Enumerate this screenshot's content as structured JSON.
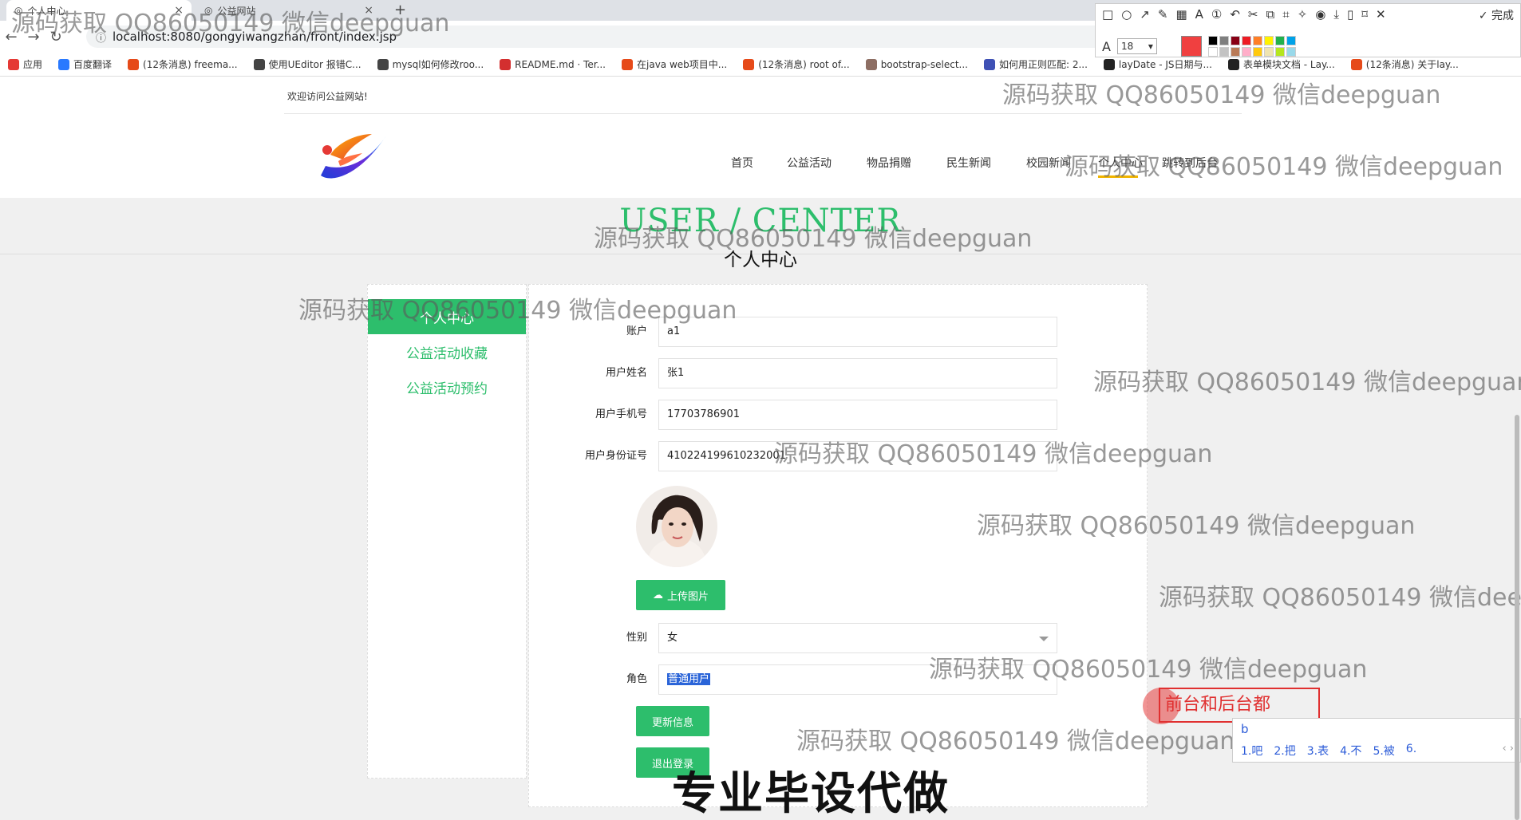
{
  "browser": {
    "tabs": [
      {
        "title": "个人中心",
        "close": "×"
      },
      {
        "title": "公益网站",
        "close": "×"
      }
    ],
    "new_tab": "+",
    "url": "localhost:8080/gongyiwangzhan/front/index.jsp",
    "bookmarks": [
      {
        "label": "应用",
        "color": "#e53935"
      },
      {
        "label": "百度翻译",
        "color": "#2979ff"
      },
      {
        "label": "(12条消息) freema...",
        "color": "#e64a19"
      },
      {
        "label": "使用UEditor 报错C...",
        "color": "#444444"
      },
      {
        "label": "mysql如何修改roo...",
        "color": "#444444"
      },
      {
        "label": "README.md · Ter...",
        "color": "#d32f2f"
      },
      {
        "label": "在java web项目中...",
        "color": "#e64a19"
      },
      {
        "label": "(12条消息) root of...",
        "color": "#e64a19"
      },
      {
        "label": "bootstrap-select...",
        "color": "#8d6e63"
      },
      {
        "label": "如何用正则匹配: 2...",
        "color": "#3f51b5"
      },
      {
        "label": "layDate - JS日期与...",
        "color": "#222222"
      },
      {
        "label": "表单模块文档 - Lay...",
        "color": "#222222"
      },
      {
        "label": "(12条消息) 关于lay...",
        "color": "#e64a19"
      }
    ]
  },
  "annotation_toolbar": {
    "tools": [
      "rectangle-icon",
      "ellipse-icon",
      "arrow-icon",
      "pen-icon",
      "mosaic-icon",
      "text-icon",
      "number-icon",
      "undo-icon",
      "pin-icon",
      "copy-icon",
      "ocr-icon",
      "translate-icon",
      "record-icon",
      "download-icon",
      "save-icon",
      "bookmark-icon",
      "close-icon"
    ],
    "done_label": "完成",
    "font_size": "18",
    "current_color": "#f04040",
    "swatches": [
      "#000000",
      "#7f7f7f",
      "#880015",
      "#ed1c24",
      "#ff7f27",
      "#fff200",
      "#22b14c",
      "#00a2e8",
      "#ffffff",
      "#c3c3c3",
      "#b97a57",
      "#ffaec9",
      "#ffc90e",
      "#efe4b0",
      "#b5e61d",
      "#99d9ea"
    ]
  },
  "site": {
    "welcome": "欢迎访问公益网站!",
    "nav": [
      "首页",
      "公益活动",
      "物品捐赠",
      "民生新闻",
      "校园新闻",
      "个人中心",
      "跳转到后台"
    ],
    "title_en": "USER / CENTER",
    "title_cn": "个人中心"
  },
  "sidebar": {
    "items": [
      "个人中心",
      "公益活动收藏",
      "公益活动预约"
    ]
  },
  "form": {
    "fields": [
      {
        "label": "账户",
        "value": "a1"
      },
      {
        "label": "用户姓名",
        "value": "张1"
      },
      {
        "label": "用户手机号",
        "value": "17703786901"
      },
      {
        "label": "用户身份证号",
        "value": "410224199610232001"
      }
    ],
    "upload_label": "上传图片",
    "gender_label": "性别",
    "gender_value": "女",
    "role_label": "角色",
    "role_value": "普通用户",
    "update_label": "更新信息",
    "logout_label": "退出登录"
  },
  "overlays": {
    "watermark": "源码获取 QQ86050149 微信deepguan",
    "banner": "专业毕设代做",
    "annotation_text": "前台和后台都",
    "ime_input": "b",
    "ime_candidates": [
      "1.吧",
      "2.把",
      "3.表",
      "4.不",
      "5.被",
      "6."
    ],
    "ime_nav": "‹ ›"
  }
}
